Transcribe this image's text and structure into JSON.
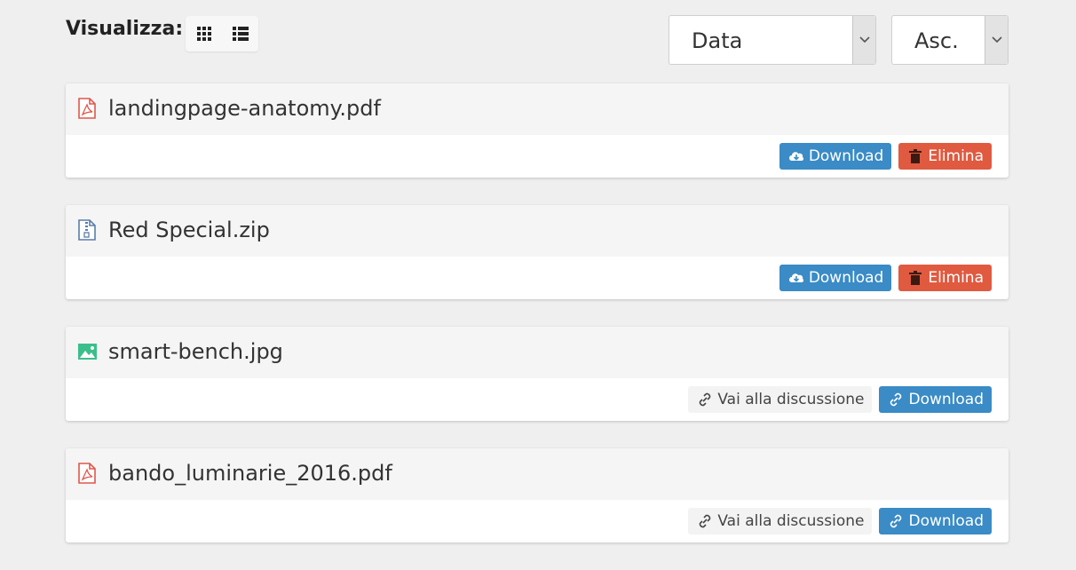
{
  "toolbar": {
    "view_label": "Visualizza:",
    "view_modes": [
      {
        "icon": "grid-icon"
      },
      {
        "icon": "list-icon"
      }
    ],
    "sort_field": "Data",
    "sort_order": "Asc."
  },
  "files": [
    {
      "name": "landingpage-anatomy.pdf",
      "icon": "pdf-file-icon",
      "actions": [
        {
          "label": "Download",
          "icon": "cloud-download-icon",
          "style": "blue"
        },
        {
          "label": "Elimina",
          "icon": "trash-icon",
          "style": "red"
        }
      ]
    },
    {
      "name": "Red Special.zip",
      "icon": "zip-file-icon",
      "actions": [
        {
          "label": "Download",
          "icon": "cloud-download-icon",
          "style": "blue"
        },
        {
          "label": "Elimina",
          "icon": "trash-icon",
          "style": "red"
        }
      ]
    },
    {
      "name": "smart-bench.jpg",
      "icon": "image-file-icon",
      "actions": [
        {
          "label": "Vai alla discussione",
          "icon": "link-icon",
          "style": "light"
        },
        {
          "label": "Download",
          "icon": "link-icon",
          "style": "blue"
        }
      ]
    },
    {
      "name": "bando_luminarie_2016.pdf",
      "icon": "pdf-file-icon",
      "actions": [
        {
          "label": "Vai alla discussione",
          "icon": "link-icon",
          "style": "light"
        },
        {
          "label": "Download",
          "icon": "link-icon",
          "style": "blue"
        }
      ]
    }
  ],
  "colors": {
    "primary": "#3a8bc6",
    "danger": "#e05a40",
    "pdf": "#e0574a",
    "zip": "#5a7ea8",
    "image": "#3bbf8a"
  }
}
